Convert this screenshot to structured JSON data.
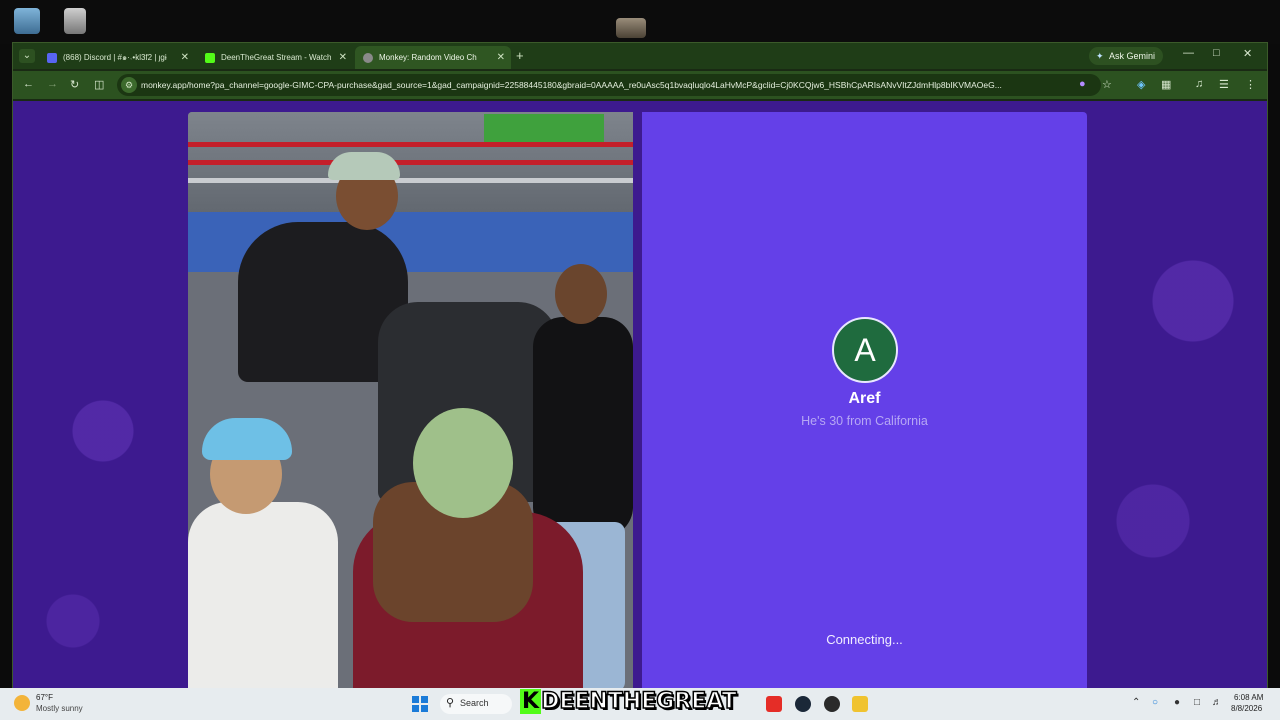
{
  "browser": {
    "tabs": [
      {
        "label": "(868) Discord | #๑·˓•kl3f2 | ȷɡɨ",
        "active": false
      },
      {
        "label": "DeenTheGreat Stream - Watch",
        "active": false
      },
      {
        "label": "Monkey: Random Video Ch",
        "active": true
      }
    ],
    "new_tab": "+",
    "gemini_label": "Ask Gemini",
    "url": "monkey.app/home?pa_channel=google-GIMC-CPA-purchase&gad_source=1&gad_campaignid=22588445180&gbraid=0AAAAA_re0uAsc5q1bvaqluqlo4LaHvMcP&gclid=Cj0KCQjw6_HSBhCpARIsANvVItZJdmHlp8bIKVMAOeG..."
  },
  "match": {
    "avatar_letter": "A",
    "name": "Aref",
    "subtitle": "He's 30 from California",
    "status": "Connecting..."
  },
  "taskbar": {
    "weather_temp": "67°F",
    "weather_desc": "Mostly sunny",
    "search_label": "Search",
    "overlay_prefix": "K",
    "overlay_text": "DEENTHEGREAT",
    "time": "6:08 AM",
    "date": "8/8/2026"
  },
  "colors": {
    "page_bg": "#3d1a8f",
    "match_panel": "#6440e8",
    "avatar": "#1f6b3e",
    "browser_frame": "#2c5220"
  }
}
